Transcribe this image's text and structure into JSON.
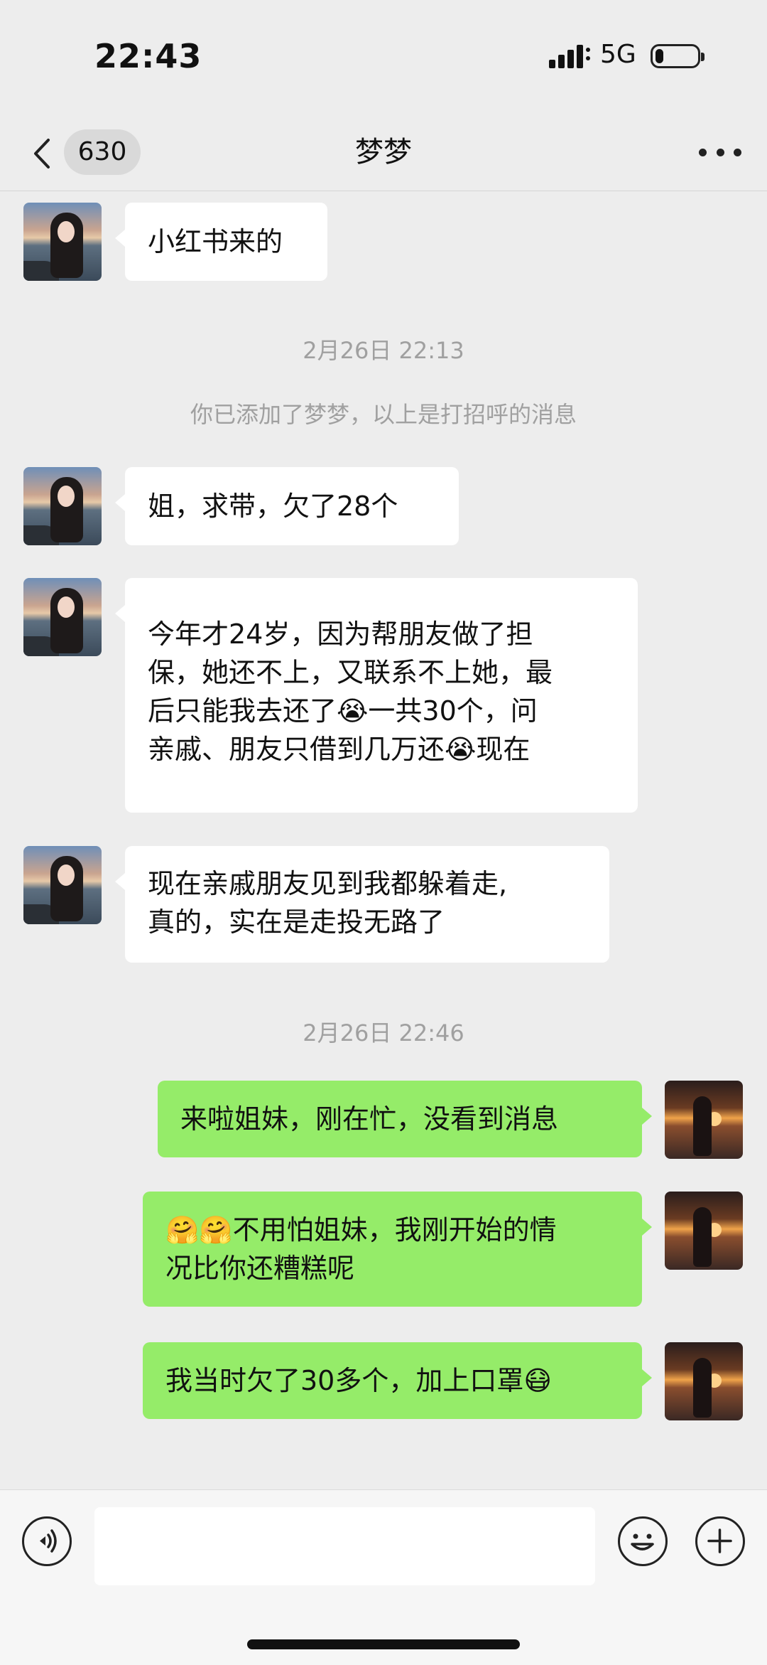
{
  "status_bar": {
    "time": "22:43",
    "network": "5G",
    "battery_level": 0.2
  },
  "nav": {
    "back_badge": "630",
    "title": "梦梦"
  },
  "messages": [
    {
      "dir": "in",
      "text": "小红书来的"
    },
    {
      "dir": "in",
      "text": "姐，求带，欠了28个"
    },
    {
      "dir": "in",
      "text": "今年才24岁，因为帮朋友做了担\n保，她还不上，又联系不上她，最\n后只能我去还了😭一共30个，问\n亲戚、朋友只借到几万还😭现在"
    },
    {
      "dir": "in",
      "text": "现在亲戚朋友见到我都躲着走,\n真的，实在是走投无路了"
    },
    {
      "dir": "out",
      "text": "来啦姐妹，刚在忙，没看到消息"
    },
    {
      "dir": "out",
      "text": "🤗🤗不用怕姐妹，我刚开始的情\n况比你还糟糕呢"
    },
    {
      "dir": "out",
      "text": "我当时欠了30多个，加上口罩😷"
    }
  ],
  "system": {
    "ts1": "2月26日 22:13",
    "added_notice": "你已添加了梦梦，以上是打招呼的消息",
    "ts2": "2月26日 22:46"
  },
  "icons": {
    "back": "chevron-left-icon",
    "more": "more-dots-icon",
    "voice": "voice-icon",
    "emoji": "emoji-icon",
    "plus": "plus-icon"
  }
}
